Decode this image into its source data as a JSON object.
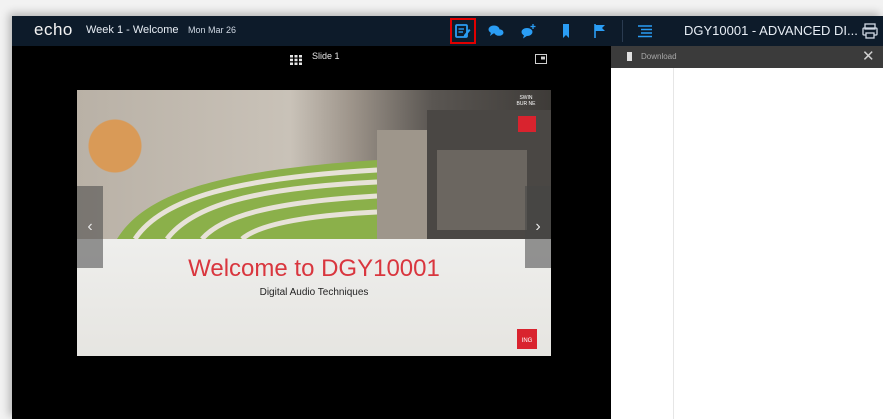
{
  "app": {
    "logo": "echo",
    "lecture_title": "Week 1 - Welcome",
    "date": "Mon Mar 26",
    "course_title": "DGY10001 - ADVANCED DI..."
  },
  "toolbar": {
    "items": [
      {
        "name": "notes-icon",
        "active": true,
        "color": "#2a9df4"
      },
      {
        "name": "discussion-icon",
        "active": false,
        "color": "#2a9df4"
      },
      {
        "name": "add-question-icon",
        "active": false,
        "color": "#2a9df4"
      },
      {
        "name": "bookmark-icon",
        "active": false,
        "color": "#2a9df4"
      },
      {
        "name": "flag-icon",
        "active": false,
        "color": "#2a9df4"
      },
      {
        "name": "outline-icon",
        "active": false,
        "color": "#2a9df4"
      }
    ]
  },
  "slide_viewer": {
    "label": "Slide 1",
    "slide_title": "Welcome to DGY10001",
    "slide_subtitle": "Digital Audio Techniques",
    "brand_text": "SWIN BUR NE",
    "badge_text": "ING",
    "prev_glyph": "‹",
    "next_glyph": "›"
  },
  "side_panel": {
    "download_label": "Download",
    "close_glyph": "✕"
  },
  "colors": {
    "topbar": "#0d1b2a",
    "accent": "#2a9df4",
    "highlight": "#e00000",
    "slide_title": "#d9363e"
  }
}
